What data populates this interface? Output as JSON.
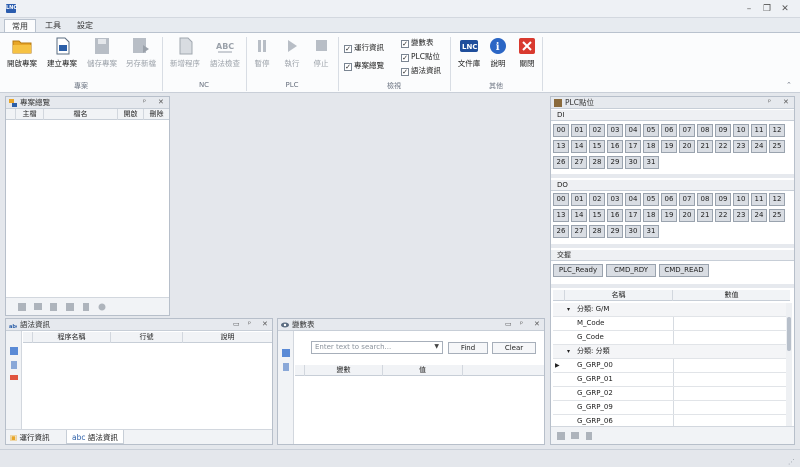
{
  "tabs": [
    "常用",
    "工具",
    "設定"
  ],
  "ribbon": {
    "project": {
      "label": "專案",
      "buttons": [
        {
          "label": "開啟專案",
          "icon": "folder-icon"
        },
        {
          "label": "建立專案",
          "icon": "new-file-icon"
        },
        {
          "label": "儲存專案",
          "icon": "save-icon"
        },
        {
          "label": "另存新檔",
          "icon": "save-as-icon"
        }
      ]
    },
    "nc": {
      "label": "NC",
      "buttons": [
        {
          "label": "新增程序",
          "icon": "new-program-icon"
        },
        {
          "label": "語法檢查",
          "icon": "abc-check-icon"
        }
      ]
    },
    "plc": {
      "label": "PLC",
      "buttons": [
        {
          "label": "暫停",
          "icon": "pause-icon"
        },
        {
          "label": "執行",
          "icon": "play-icon"
        },
        {
          "label": "停止",
          "icon": "stop-icon"
        }
      ]
    },
    "view": {
      "label": "檢視",
      "checks": [
        {
          "label": "運行資訊",
          "checked": true
        },
        {
          "label": "專案總覽",
          "checked": true
        },
        {
          "label": "變數表",
          "checked": true
        },
        {
          "label": "PLC點位",
          "checked": true
        },
        {
          "label": "語法資訊",
          "checked": true
        }
      ]
    },
    "other": {
      "label": "其他",
      "buttons": [
        {
          "label": "文件庫",
          "icon": "lnc-logo-icon"
        },
        {
          "label": "說明",
          "icon": "info-icon"
        },
        {
          "label": "關閉",
          "icon": "close-icon"
        }
      ]
    }
  },
  "project_panel": {
    "title": "專案總覽",
    "columns": [
      "主檔",
      "檔名",
      "開啟",
      "刪除"
    ]
  },
  "syntax_panel": {
    "title": "語法資訊",
    "columns": [
      "程序名稱",
      "行號",
      "說明"
    ],
    "bottom_tabs": [
      "運行資訊",
      "語法資訊"
    ]
  },
  "variable_panel": {
    "title": "變數表",
    "search_placeholder": "Enter text to search...",
    "find_label": "Find",
    "clear_label": "Clear",
    "columns": [
      "變數",
      "值"
    ]
  },
  "plc_panel": {
    "title": "PLC點位",
    "di_label": "DI",
    "do_label": "DO",
    "di_cells": [
      "00",
      "01",
      "02",
      "03",
      "04",
      "05",
      "06",
      "07",
      "08",
      "09",
      "10",
      "11",
      "12",
      "13",
      "14",
      "15",
      "16",
      "17",
      "18",
      "19",
      "20",
      "21",
      "22",
      "23",
      "24",
      "25",
      "26",
      "27",
      "28",
      "29",
      "30",
      "31"
    ],
    "do_cells": [
      "00",
      "01",
      "02",
      "03",
      "04",
      "05",
      "06",
      "07",
      "08",
      "09",
      "10",
      "11",
      "12",
      "13",
      "14",
      "15",
      "16",
      "17",
      "18",
      "19",
      "20",
      "21",
      "22",
      "23",
      "24",
      "25",
      "26",
      "27",
      "28",
      "29",
      "30",
      "31"
    ],
    "handshake_label": "交握",
    "handshake_buttons": [
      "PLC_Ready",
      "CMD_RDY",
      "CMD_READ"
    ],
    "prop_columns": [
      "名稱",
      "數值"
    ],
    "prop_rows": [
      {
        "label": "分類: G/M",
        "group": true
      },
      {
        "label": "M_Code",
        "group": false
      },
      {
        "label": "G_Code",
        "group": false
      },
      {
        "label": "分類: 分類",
        "group": true
      },
      {
        "label": "G_GRP_00",
        "group": false,
        "selected": true
      },
      {
        "label": "G_GRP_01",
        "group": false
      },
      {
        "label": "G_GRP_02",
        "group": false
      },
      {
        "label": "G_GRP_09",
        "group": false
      },
      {
        "label": "G_GRP_06",
        "group": false
      }
    ]
  }
}
